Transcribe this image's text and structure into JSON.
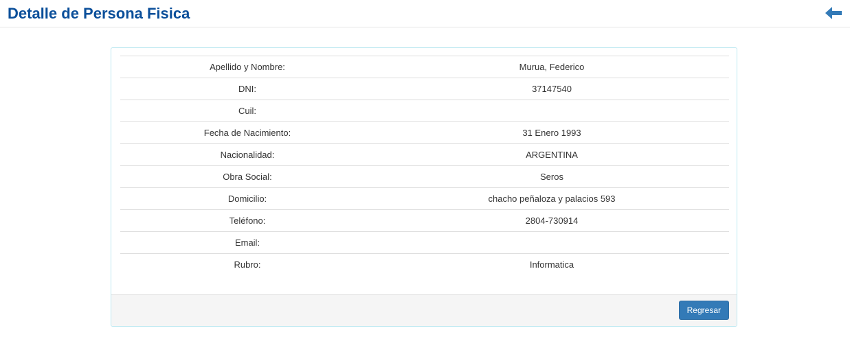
{
  "header": {
    "title": "Detalle de Persona Fisica",
    "back_icon": "arrow-left-icon",
    "accent_color": "#0b4f9a"
  },
  "details": [
    {
      "label": "Apellido y Nombre:",
      "value": "Murua, Federico"
    },
    {
      "label": "DNI:",
      "value": "37147540"
    },
    {
      "label": "Cuil:",
      "value": ""
    },
    {
      "label": "Fecha de Nacimiento:",
      "value": "31 Enero 1993"
    },
    {
      "label": "Nacionalidad:",
      "value": "ARGENTINA"
    },
    {
      "label": "Obra Social:",
      "value": "Seros"
    },
    {
      "label": "Domicilio:",
      "value": "chacho peñaloza y palacios 593"
    },
    {
      "label": "Teléfono:",
      "value": "2804-730914"
    },
    {
      "label": "Email:",
      "value": ""
    },
    {
      "label": "Rubro:",
      "value": "Informatica"
    }
  ],
  "footer": {
    "back_button_label": "Regresar",
    "button_color": "#337ab7"
  }
}
